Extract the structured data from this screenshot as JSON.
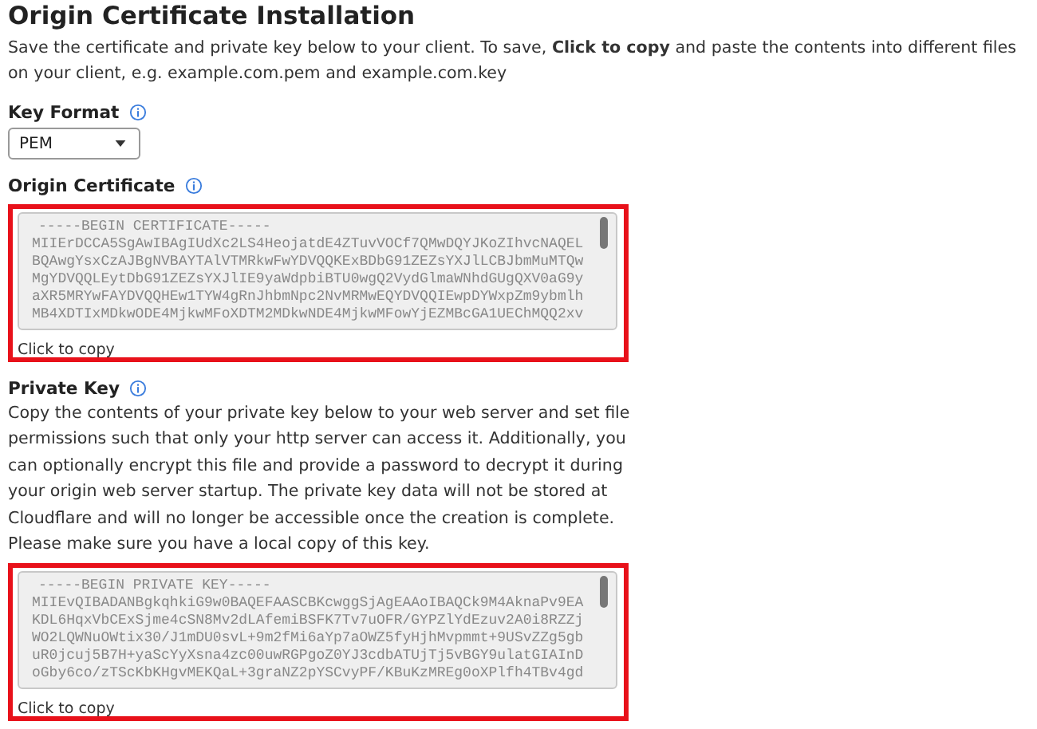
{
  "title": "Origin Certificate Installation",
  "intro": "Save the certificate and private key below to your client. To save, **Click to copy** and paste the contents into different files on your client, e.g. example.com.pem and example.com.key",
  "key_format": {
    "label": "Key Format",
    "value": "PEM"
  },
  "certificate": {
    "label": "Origin Certificate",
    "highlighted": true,
    "copy_label": "Click to copy",
    "lines": [
      "-----BEGIN CERTIFICATE-----",
      "MIIErDCCA5SgAwIBAgIUdXc2LS4HeojatdE4ZTuvVOCf7QMwDQYJKoZIhvcNAQEL",
      "BQAwgYsxCzAJBgNVBAYTAlVTMRkwFwYDVQQKExBDbG91ZEZsYXJlLCBJbmMuMTQw",
      "MgYDVQQLEytDbG91ZEZsYXJlIE9yaWdpbiBTU0wgQ2VydGlmaWNhdGUgQXV0aG9y",
      "aXR5MRYwFAYDVQQHEw1TYW4gRnJhbmNpc2NvMRMwEQYDVQQIEwpDYWxpZm9ybmlh",
      "MB4XDTIxMDkwODE4MjkwMFoXDTM2MDkwNDE4MjkwMFowYjEZMBcGA1UEChMQQ2xv"
    ]
  },
  "private_key": {
    "label": "Private Key",
    "highlighted": true,
    "description": "Copy the contents of your private key below to your web server and set file permissions such that only your http server can access it. Additionally, you can optionally encrypt this file and provide a password to decrypt it during your origin web server startup. The private key data will not be stored at Cloudflare and will no longer be accessible once the creation is complete. Please make sure you have a local copy of this key.",
    "copy_label": "Click to copy",
    "lines": [
      "-----BEGIN PRIVATE KEY-----",
      "MIIEvQIBADANBgkqhkiG9w0BAQEFAASCBKcwggSjAgEAAoIBAQCk9M4AknaPv9EA",
      "KDL6HqxVbCExSjme4cSN8Mv2dLAfemiBSFK7Tv7uOFR/GYPZlYdEzuv2A0i8RZZj",
      "WO2LQWNuOWtix30/J1mDU0svL+9m2fMi6aYp7aOWZ5fyHjhMvpmmt+9USvZZg5gb",
      "uR0jcuj5B7H+yaScYyXsna4zc00uwRGPgoZ0YJ3cdbATUjTj5vBGY9ulatGIAInD",
      "oGby6co/zTScKbKHgvMEKQaL+3graNZ2pYSCvyPF/KBuKzMREg0oXPlfh4TBv4gd"
    ]
  }
}
